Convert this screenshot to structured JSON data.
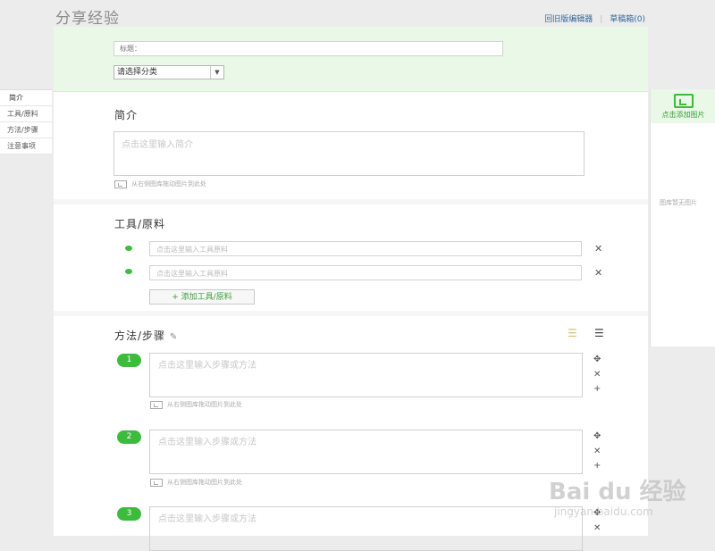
{
  "page": {
    "title": "分享经验"
  },
  "toplinks": {
    "old_editor": "回旧版编辑器",
    "drafts": "草稿箱(0)"
  },
  "leftnav": {
    "items": [
      "简介",
      "工具/原料",
      "方法/步骤",
      "注意事项"
    ]
  },
  "header": {
    "title_placeholder": "标题：",
    "category_selected": "请选择分类"
  },
  "intro": {
    "title": "简介",
    "placeholder": "点击这里输入简介",
    "img_hint": "从右侧图库拖动图片到此处"
  },
  "tools": {
    "title": "工具/原料",
    "items": [
      "点击这里输入工具原料",
      "点击这里输入工具原料"
    ],
    "add_label": "+ 添加工具/原料"
  },
  "steps": {
    "title": "方法/步骤",
    "placeholder": "点击这里输入步骤或方法",
    "img_hint": "从右侧图库拖动图片到此处",
    "numbers": [
      "1",
      "2",
      "3"
    ]
  },
  "right_panel": {
    "add_image_label": "点击添加图片",
    "no_image": "图库暂无图片"
  },
  "watermark": {
    "logo": "Bai du 经验",
    "url": "jingyan.baidu.com"
  },
  "colors": {
    "accent": "#3dbb3d",
    "header_bg": "#e9f8e7",
    "link": "#336699"
  }
}
